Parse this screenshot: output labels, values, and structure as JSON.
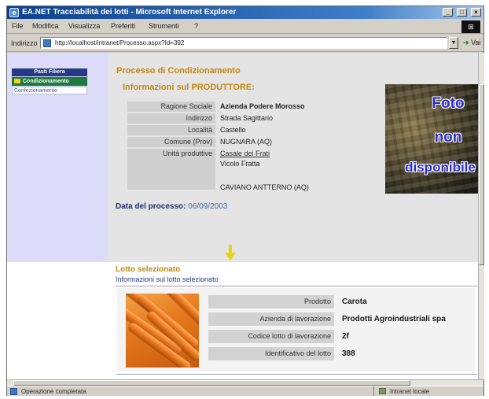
{
  "window": {
    "title": "EA.NET Tracciabilità dei lotti - Microsoft Internet Explorer",
    "buttons": [
      "_",
      "□",
      "×"
    ]
  },
  "menu": {
    "items": [
      "File",
      "Modifica",
      "Visualizza",
      "Preferiti",
      "Strumenti",
      "?"
    ]
  },
  "address": {
    "label": "Indirizzo",
    "url": "http://localhost/intranet/Processo.aspx?Id=392",
    "go_label": "Vai"
  },
  "status": {
    "text": "Operazione completata",
    "zone": "Intranet locale"
  },
  "nav": {
    "items": [
      "Pasti Filiera",
      "Condizionamento",
      "Confezionamento"
    ]
  },
  "page": {
    "title": "Processo di Condizionamento",
    "producer_section": "Informazioni sul PRODUTTORE:",
    "date_label": "Data del processo:",
    "date_value": "06/09/2003"
  },
  "producer": {
    "fields": [
      {
        "label": "Ragione Sociale",
        "value": "Azienda Podere Morosso"
      },
      {
        "label": "Indirizzo",
        "value": "Strada Sagittario"
      },
      {
        "label": "Località",
        "value": "Castello"
      },
      {
        "label": "Comune (Prov)",
        "value": "NUGNARA (AQ)"
      },
      {
        "label": "Unità produttive",
        "value": "Casale dei Frati"
      }
    ],
    "unit_extra": [
      "Vicolo Fratta",
      "CAVIANO ANTTERNO (AQ)"
    ]
  },
  "photo": {
    "placeholder": [
      "Foto",
      "non",
      "disponibile"
    ]
  },
  "lotto": {
    "title": "Lotto selezionato",
    "subtitle": "Informazioni sul lotto selezionato",
    "fields": [
      {
        "label": "Prodotto",
        "value": "Carota"
      },
      {
        "label": "Azienda di lavorazione",
        "value": "Prodotti Agroindustriali spa"
      },
      {
        "label": "Codice lotto di lavorazione",
        "value": "2f"
      },
      {
        "label": "Identificativo del lotto",
        "value": "388"
      }
    ]
  },
  "colors": {
    "accent": "#c08a10",
    "nav_active": "#1e7a3a",
    "nav_header": "#243a82",
    "left_panel": "#dcdcfa"
  }
}
